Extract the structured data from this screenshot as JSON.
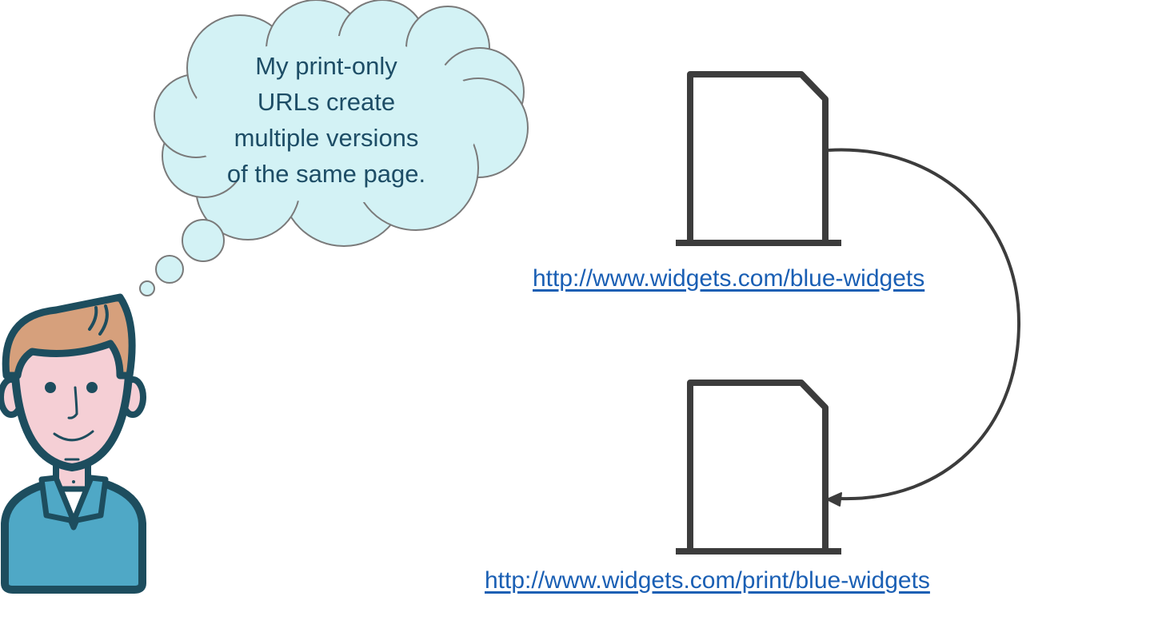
{
  "thought_bubble": {
    "lines": [
      "My print-only",
      "URLs create",
      "multiple versions",
      "of the same page."
    ]
  },
  "pages": {
    "top_url": "http://www.widgets.com/blue-widgets",
    "bottom_url": "http://www.widgets.com/print/blue-widgets"
  },
  "colors": {
    "cloud_fill": "#d3f2f5",
    "cloud_stroke": "#7a7a7a",
    "document_stroke": "#3c3c3c",
    "link": "#1a5fb4",
    "text": "#1d4d66",
    "skin": "#f5cfd5",
    "hair": "#d6a07c",
    "shirt": "#4fa8c6",
    "outline": "#1d4d5e"
  },
  "icons": [
    "person-avatar-icon",
    "thought-cloud-icon",
    "document-icon",
    "redirect-arrow-icon"
  ]
}
